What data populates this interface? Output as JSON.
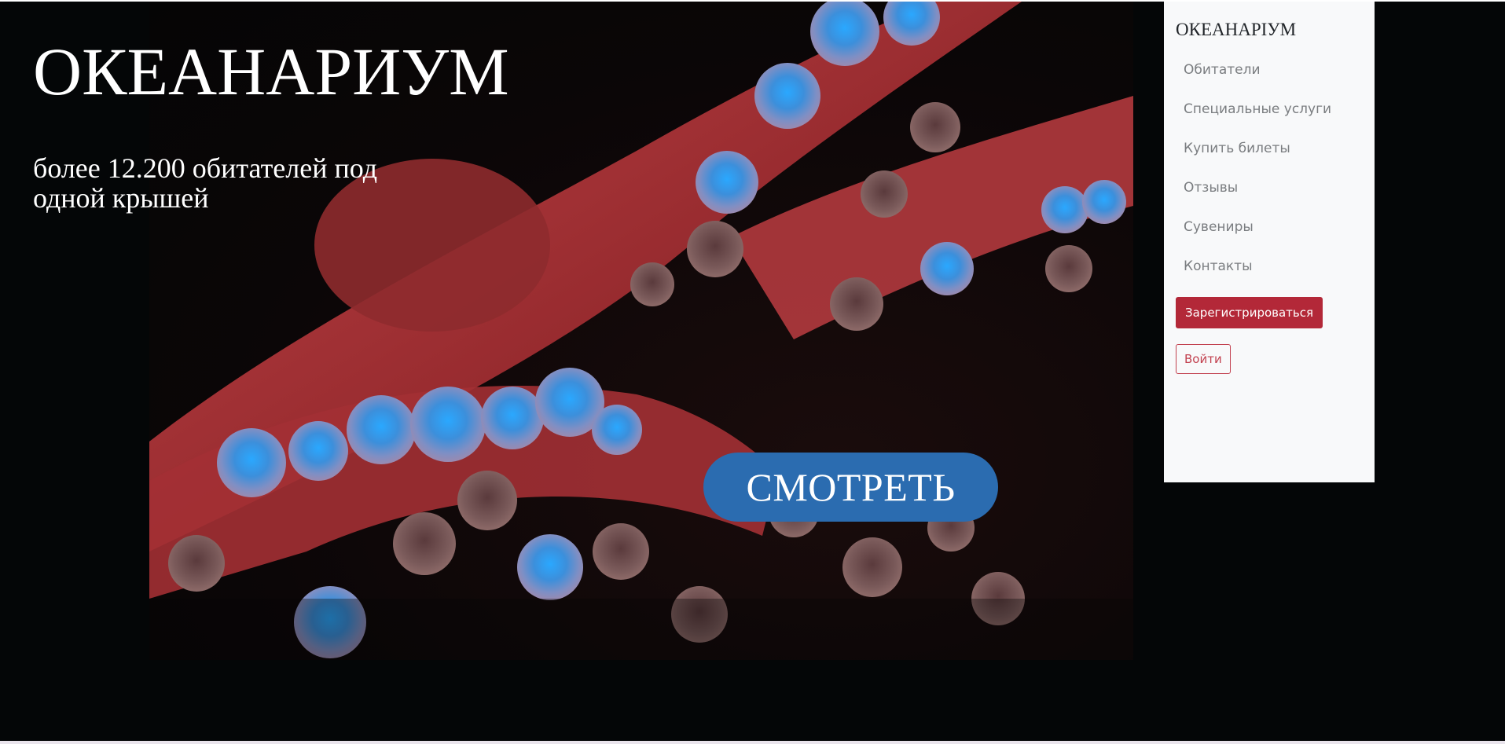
{
  "hero": {
    "title": "ОКЕАНАРИУМ",
    "subtitle": "более 12.200 обитателей под одной крышей",
    "watch_label": "СМОТРЕТЬ",
    "image_icon": "octopus-photo",
    "background_color": "#040607"
  },
  "sidebar": {
    "brand": "ОКЕАНАРIУМ",
    "items": [
      {
        "label": "Обитатели"
      },
      {
        "label": "Специальные услуги"
      },
      {
        "label": "Купить билеты"
      },
      {
        "label": "Отзывы"
      },
      {
        "label": "Сувениры"
      },
      {
        "label": "Контакты"
      }
    ],
    "register_label": "Зарегистрироваться",
    "login_label": "Войти",
    "background_color": "#f8f9fa"
  },
  "colors": {
    "accent_blue": "#2b6cb0",
    "accent_red": "#b32838"
  }
}
